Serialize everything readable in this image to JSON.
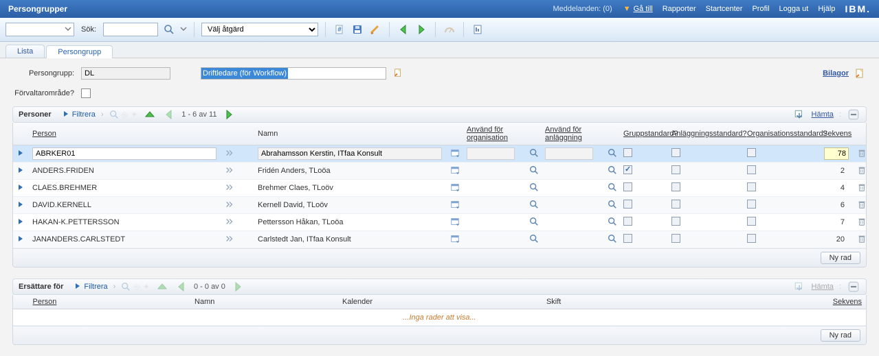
{
  "topbar": {
    "title": "Persongrupper",
    "messages": "Meddelanden: (0)",
    "goto": "Gå till",
    "links": [
      "Rapporter",
      "Startcenter",
      "Profil",
      "Logga ut",
      "Hjälp"
    ],
    "ibm": "IBM."
  },
  "toolbar": {
    "search_label": "Sök:",
    "action_placeholder": "Välj åtgärd"
  },
  "tabs": {
    "list": "Lista",
    "group": "Persongrupp"
  },
  "form": {
    "group_label": "Persongrupp:",
    "group_value": "DL",
    "group_desc": "Driftledare (för Workflow)",
    "forvalt_label": "Förvaltarområde?",
    "bilagor": "Bilagor"
  },
  "personer": {
    "title": "Personer",
    "filter": "Filtrera",
    "range": "1 - 6 av 11",
    "fetch": "Hämta",
    "columns": {
      "person": "Person",
      "namn": "Namn",
      "org": "Använd för organisation",
      "anl": "Använd för anläggning",
      "gstd": "Gruppstandard?",
      "astd": "Anläggningsstandard?",
      "ostd": "Organisationsstandard?",
      "seq": "Sekvens"
    },
    "rows": [
      {
        "selected": true,
        "person": "ABRKER01",
        "namn": "Abrahamsson Kerstin, ITfaa Konsult",
        "gstd": false,
        "astd": false,
        "ostd": false,
        "seq": "78"
      },
      {
        "selected": false,
        "person": "ANDERS.FRIDEN",
        "namn": "Fridén Anders, TLoöa",
        "gstd": true,
        "astd": false,
        "ostd": false,
        "seq": "2"
      },
      {
        "selected": false,
        "person": "CLAES.BREHMER",
        "namn": "Brehmer Claes, TLoöv",
        "gstd": false,
        "astd": false,
        "ostd": false,
        "seq": "4"
      },
      {
        "selected": false,
        "person": "DAVID.KERNELL",
        "namn": "Kernell David, TLoöv",
        "gstd": false,
        "astd": false,
        "ostd": false,
        "seq": "6"
      },
      {
        "selected": false,
        "person": "HAKAN-K.PETTERSSON",
        "namn": "Pettersson Håkan, TLoöa",
        "gstd": false,
        "astd": false,
        "ostd": false,
        "seq": "7"
      },
      {
        "selected": false,
        "person": "JANANDERS.CARLSTEDT",
        "namn": "Carlstedt Jan, ITfaa Konsult",
        "gstd": false,
        "astd": false,
        "ostd": false,
        "seq": "20"
      }
    ],
    "newrow": "Ny rad"
  },
  "ersattare": {
    "title": "Ersättare för",
    "filter": "Filtrera",
    "range": "0 - 0 av 0",
    "fetch": "Hämta",
    "columns": {
      "person": "Person",
      "namn": "Namn",
      "kalender": "Kalender",
      "skift": "Skift",
      "seq": "Sekvens"
    },
    "empty": "...Inga rader att visa...",
    "newrow": "Ny rad"
  }
}
